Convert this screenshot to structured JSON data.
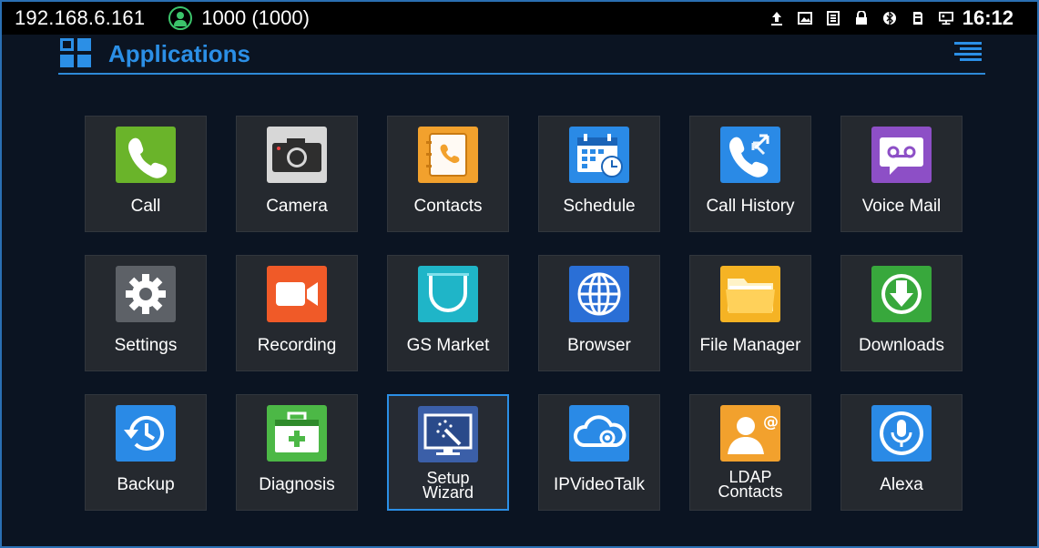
{
  "status_bar": {
    "ip": "192.168.6.161",
    "account": "1000 (1000)",
    "time": "16:12",
    "icons": [
      "upload-icon",
      "image-icon",
      "sim-icon",
      "lock-icon",
      "bluetooth-icon",
      "sd-card-icon",
      "network-icon"
    ]
  },
  "header": {
    "title": "Applications",
    "accent_color": "#2b8fe6"
  },
  "apps": [
    {
      "label": "Call",
      "icon": "phone-icon",
      "color": "#6ab42a"
    },
    {
      "label": "Camera",
      "icon": "camera-icon",
      "color": "#d7d7d7"
    },
    {
      "label": "Contacts",
      "icon": "contacts-book-icon",
      "color": "#f2a12d"
    },
    {
      "label": "Schedule",
      "icon": "calendar-clock-icon",
      "color": "#2a8ae6"
    },
    {
      "label": "Call History",
      "icon": "call-history-icon",
      "color": "#2a8ae6"
    },
    {
      "label": "Voice Mail",
      "icon": "voicemail-icon",
      "color": "#8d4fc6"
    },
    {
      "label": "Settings",
      "icon": "gear-icon",
      "color": "#5d6167"
    },
    {
      "label": "Recording",
      "icon": "video-record-icon",
      "color": "#f05a28"
    },
    {
      "label": "GS Market",
      "icon": "market-bag-icon",
      "color": "#1fb5c8"
    },
    {
      "label": "Browser",
      "icon": "globe-icon",
      "color": "#2a6fd6"
    },
    {
      "label": "File Manager",
      "icon": "folder-icon",
      "color": "#f5b324"
    },
    {
      "label": "Downloads",
      "icon": "download-icon",
      "color": "#38a83c"
    },
    {
      "label": "Backup",
      "icon": "backup-restore-icon",
      "color": "#2a8ae6"
    },
    {
      "label": "Diagnosis",
      "icon": "first-aid-kit-icon",
      "color": "#4cb846"
    },
    {
      "label": "Setup\nWizard",
      "icon": "setup-wizard-icon",
      "color": "#3b5fa8",
      "selected": true
    },
    {
      "label": "IPVideoTalk",
      "icon": "cloud-video-icon",
      "color": "#2a8ae6"
    },
    {
      "label": "LDAP\nContacts",
      "icon": "ldap-contact-icon",
      "color": "#f2a12d"
    },
    {
      "label": "Alexa",
      "icon": "microphone-icon",
      "color": "#2a8ae6"
    }
  ]
}
